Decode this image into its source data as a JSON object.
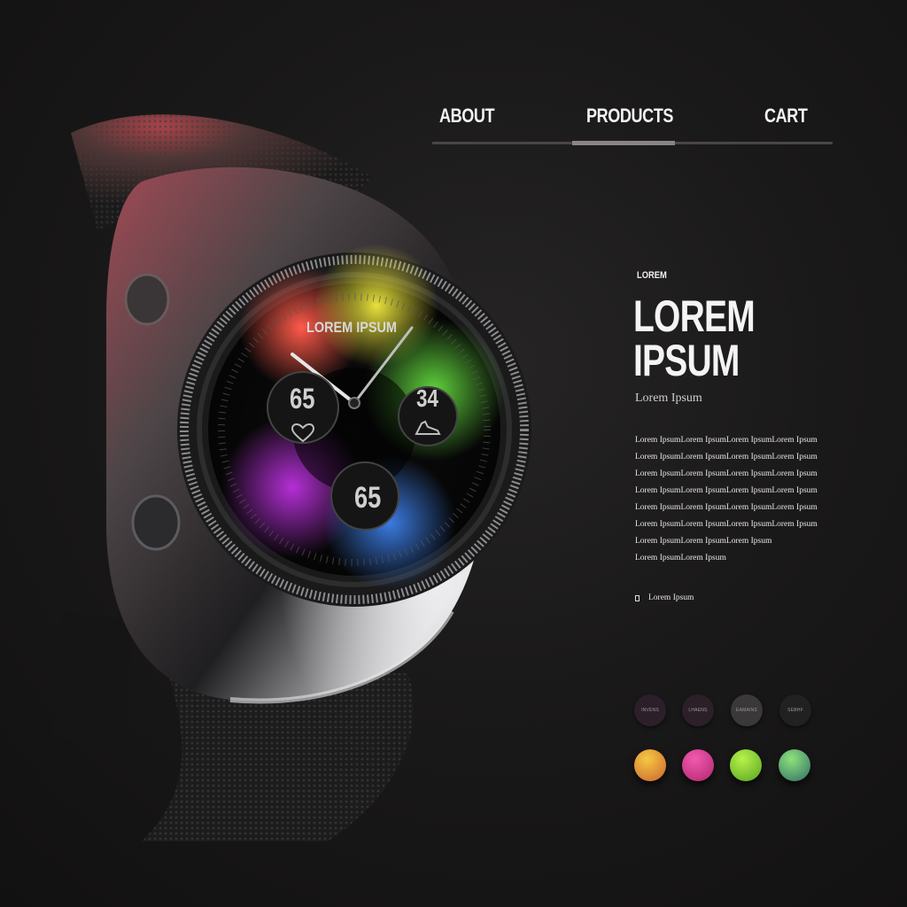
{
  "nav": {
    "items": [
      {
        "label": "ABOUT",
        "active": false
      },
      {
        "label": "PRODUCTS",
        "active": true
      },
      {
        "label": "CART",
        "active": false
      }
    ]
  },
  "hero": {
    "eyebrow": "LOREM",
    "headline_line1": "LOREM",
    "headline_line2": "IPSUM",
    "subhead": "Lorem Ipsum",
    "paragraph_lines": [
      "Lorem IpsumLorem IpsumLorem IpsumLorem Ipsum",
      "Lorem IpsumLorem IpsumLorem IpsumLorem Ipsum",
      "Lorem IpsumLorem IpsumLorem IpsumLorem Ipsum",
      "Lorem IpsumLorem IpsumLorem IpsumLorem Ipsum",
      "Lorem IpsumLorem IpsumLorem IpsumLorem Ipsum",
      "Lorem IpsumLorem IpsumLorem IpsumLorem Ipsum",
      "Lorem IpsumLorem IpsumLorem Ipsum",
      "Lorem IpsumLorem Ipsum"
    ],
    "link_label": "Lorem Ipsum"
  },
  "options": {
    "chips": [
      {
        "label": "INVENS",
        "color": "#2b1f2a"
      },
      {
        "label": "LHAENS",
        "color": "#2c2028"
      },
      {
        "label": "EAMAINS",
        "color": "#3a3838"
      },
      {
        "label": "SEBHF",
        "color": "#222121"
      }
    ],
    "swatches": [
      {
        "name": "orange-yellow",
        "from": "#f6c843",
        "to": "#c9652e"
      },
      {
        "name": "pink",
        "from": "#f25ab0",
        "to": "#b0266e"
      },
      {
        "name": "lime",
        "from": "#b8f24a",
        "to": "#57a322"
      },
      {
        "name": "green-teal",
        "from": "#8ee27a",
        "to": "#2f6d6a"
      }
    ]
  },
  "watch_face": {
    "title": "LOREM IPSUM",
    "left_dial_value": "65",
    "right_dial_value": "34",
    "bottom_dial_value": "65",
    "left_dial_icon": "heart-icon",
    "right_dial_icon": "shoe-icon"
  },
  "colors": {
    "background": "#161515",
    "nav_active": "#8a8485",
    "nav_line": "#4a4546",
    "text": "#f4f4f4"
  }
}
